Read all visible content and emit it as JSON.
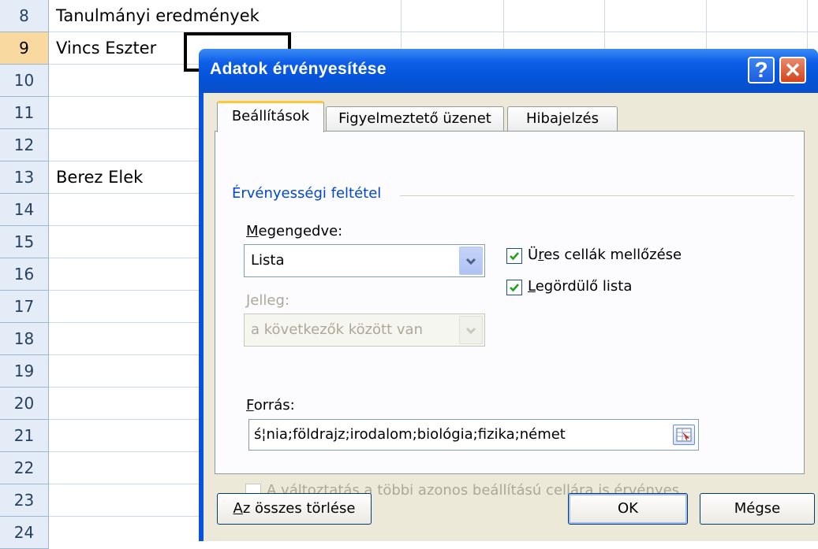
{
  "sheet": {
    "rows": [
      {
        "num": "8",
        "value": "Tanulmányi eredmények"
      },
      {
        "num": "9",
        "value": "Vincs Eszter"
      },
      {
        "num": "10",
        "value": ""
      },
      {
        "num": "11",
        "value": ""
      },
      {
        "num": "12",
        "value": ""
      },
      {
        "num": "13",
        "value": "Berez Elek"
      },
      {
        "num": "14",
        "value": ""
      },
      {
        "num": "15",
        "value": ""
      },
      {
        "num": "16",
        "value": ""
      },
      {
        "num": "17",
        "value": ""
      },
      {
        "num": "18",
        "value": ""
      },
      {
        "num": "19",
        "value": ""
      },
      {
        "num": "20",
        "value": ""
      },
      {
        "num": "21",
        "value": ""
      },
      {
        "num": "22",
        "value": ""
      },
      {
        "num": "23",
        "value": ""
      },
      {
        "num": "24",
        "value": ""
      }
    ],
    "selected_row": "9"
  },
  "dialog": {
    "title": "Adatok érvényesítése",
    "tabs": [
      {
        "label": "Beállítások",
        "active": true
      },
      {
        "label": "Figyelmeztető üzenet",
        "active": false
      },
      {
        "label": "Hibajelzés",
        "active": false
      }
    ],
    "group_label": "Érvényességi feltétel",
    "allow": {
      "label_mnemonic": "M",
      "label_rest": "egengedve:",
      "value": "Lista"
    },
    "data": {
      "label": "Jelleg:",
      "value": "a következők között van",
      "disabled": true
    },
    "ignore_blank": {
      "checked": true,
      "label_pre": "Ü",
      "label_mnemonic": "r",
      "label_post": "es cellák mellőzése"
    },
    "in_cell_dropdown": {
      "checked": true,
      "label_mnemonic": "L",
      "label_rest": "egördülő lista"
    },
    "source": {
      "label_mnemonic": "F",
      "label_rest": "orrás:",
      "value": "ś¦nia;földrajz;irodalom;biológia;fizika;német"
    },
    "apply_all": {
      "checked": false,
      "label": "A változtatás a többi azonos beállítású cellára is érvényes",
      "disabled": true
    },
    "buttons": {
      "clear_mnemonic": "A",
      "clear_rest": "z összes törlése",
      "ok": "OK",
      "cancel": "Mégse"
    },
    "help_glyph": "?",
    "close_glyph": "✕"
  },
  "colors": {
    "title_bar": "#0452d8",
    "group_label": "#0046d5",
    "active_tab_accent": "#ffc83c",
    "row_header": "#e4ecf7",
    "selected_row_header": "#f9d99f"
  }
}
